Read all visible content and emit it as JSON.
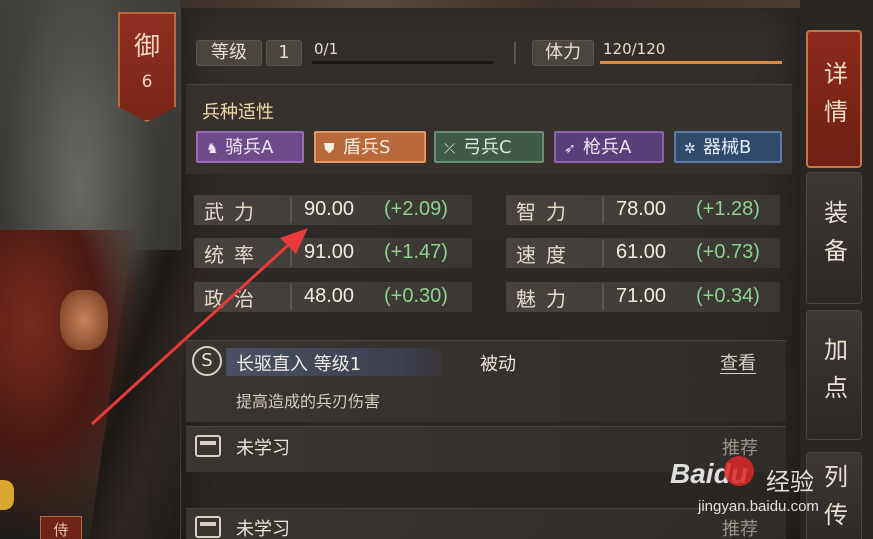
{
  "rank": {
    "title": "御",
    "number": "6"
  },
  "level": {
    "label": "等级",
    "value": "1",
    "exp_text": "0/1",
    "exp_fraction": 0.0
  },
  "stamina": {
    "label": "体力",
    "value_text": "120/120",
    "fraction": 1.0
  },
  "aptitude": {
    "title": "兵种适性",
    "badges": [
      {
        "label": "骑兵A",
        "icon": "horse-icon",
        "bg": "#6e4a8a",
        "border": "#9a6cbc",
        "color": "#f0e6f6"
      },
      {
        "label": "盾兵S",
        "icon": "shield-icon",
        "bg": "#b8683a",
        "border": "#e09a62",
        "color": "#fbeee2"
      },
      {
        "label": "弓兵C",
        "icon": "bow-icon",
        "bg": "#3f5a48",
        "border": "#6b8e74",
        "color": "#d8ead8"
      },
      {
        "label": "枪兵A",
        "icon": "spear-icon",
        "bg": "#5a3f78",
        "border": "#8a64b0",
        "color": "#efe6f6"
      },
      {
        "label": "器械B",
        "icon": "gear-icon",
        "bg": "#2f4a6a",
        "border": "#5a7ea8",
        "color": "#e2ecf6"
      }
    ]
  },
  "stats": [
    {
      "label": "武力",
      "value": "90.00",
      "bonus": "(+2.09)"
    },
    {
      "label": "智力",
      "value": "78.00",
      "bonus": "(+1.28)"
    },
    {
      "label": "统率",
      "value": "91.00",
      "bonus": "(+1.47)"
    },
    {
      "label": "速度",
      "value": "61.00",
      "bonus": "(+0.73)"
    },
    {
      "label": "政治",
      "value": "48.00",
      "bonus": "(+0.30)"
    },
    {
      "label": "魅力",
      "value": "71.00",
      "bonus": "(+0.34)"
    }
  ],
  "skill": {
    "grade": "S",
    "name": "长驱直入 等级1",
    "type": "被动",
    "view": "查看",
    "description": "提高造成的兵刃伤害"
  },
  "slots": [
    {
      "label": "未学习",
      "recommend": "推荐"
    },
    {
      "label": "未学习",
      "recommend": "推荐"
    }
  ],
  "tabs": [
    {
      "label": "详情",
      "active": true
    },
    {
      "label": "装备",
      "active": false
    },
    {
      "label": "加点",
      "active": false
    },
    {
      "label": "列传",
      "active": false
    }
  ],
  "bottom_banner": "侍",
  "watermark": {
    "logo": "Baidu",
    "cn": "经验",
    "url": "jingyan.baidu.com"
  }
}
